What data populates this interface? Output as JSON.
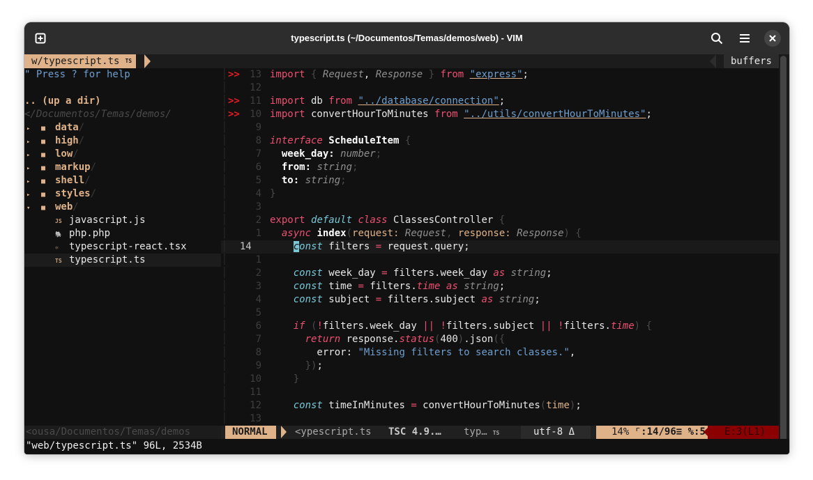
{
  "window": {
    "title": "typescript.ts (~/Documentos/Temas/demos/web) - VIM",
    "new_tab_icon": "plus-square-icon",
    "search_icon": "search-icon",
    "menu_icon": "hamburger-menu-icon",
    "close_icon": "close-icon"
  },
  "tabline": {
    "active_tab": "w/typescript.ts",
    "active_tab_badge": "TS",
    "right_label": "buffers"
  },
  "tree": {
    "help": "\" Press ? for help",
    "updir": ".. (up a dir)",
    "cwd": "</Documentos/Temas/demos/",
    "dirs": [
      {
        "name": "data",
        "expanded": false
      },
      {
        "name": "high",
        "expanded": false
      },
      {
        "name": "low",
        "expanded": false
      },
      {
        "name": "markup",
        "expanded": false
      },
      {
        "name": "shell",
        "expanded": false
      },
      {
        "name": "styles",
        "expanded": false
      },
      {
        "name": "web",
        "expanded": true
      }
    ],
    "dir_slash": "/",
    "collapsed_glyph": "▸",
    "expanded_glyph": "▾",
    "folder_glyph": "■",
    "files": [
      {
        "icon": "JS",
        "name": "javascript.js"
      },
      {
        "icon": "🐘",
        "name": "php.php"
      },
      {
        "icon": "⚛",
        "name": "typescript-react.tsx"
      },
      {
        "icon": "TS",
        "name": "typescript.ts",
        "selected": true
      }
    ]
  },
  "editor": {
    "sign_marker": ">>",
    "current_line": "14",
    "lines": [
      {
        "sign": ">>",
        "nr": "13"
      },
      {
        "sign": "",
        "nr": "12"
      },
      {
        "sign": ">>",
        "nr": "11"
      },
      {
        "sign": ">>",
        "nr": "10"
      },
      {
        "sign": "",
        "nr": "9"
      },
      {
        "sign": "",
        "nr": "8"
      },
      {
        "sign": "",
        "nr": "7"
      },
      {
        "sign": "",
        "nr": "6"
      },
      {
        "sign": "",
        "nr": "5"
      },
      {
        "sign": "",
        "nr": "4"
      },
      {
        "sign": "",
        "nr": "3"
      },
      {
        "sign": "",
        "nr": "2"
      },
      {
        "sign": "",
        "nr": "1"
      },
      {
        "sign": "",
        "nr": "14"
      },
      {
        "sign": "",
        "nr": "1"
      },
      {
        "sign": "",
        "nr": "2"
      },
      {
        "sign": "",
        "nr": "3"
      },
      {
        "sign": "",
        "nr": "4"
      },
      {
        "sign": "",
        "nr": "5"
      },
      {
        "sign": "",
        "nr": "6"
      },
      {
        "sign": "",
        "nr": "7"
      },
      {
        "sign": "",
        "nr": "8"
      },
      {
        "sign": "",
        "nr": "9"
      },
      {
        "sign": "",
        "nr": "10"
      },
      {
        "sign": "",
        "nr": "11"
      },
      {
        "sign": "",
        "nr": "12"
      },
      {
        "sign": "",
        "nr": "13"
      }
    ],
    "code": {
      "import": "import",
      "from": "from",
      "request_t": "Request",
      "response_t": "Response",
      "express": "\"express\"",
      "db": "db",
      "db_path": "\"../database/connection\"",
      "convert": "convertHourToMinutes",
      "convert_path": "\"../utils/convertHourToMinutes\"",
      "interface": "interface",
      "schedule": "ScheduleItem",
      "week_day": "week_day",
      "from_field": "from",
      "to_field": "to",
      "number": "number",
      "string": "string",
      "export": "export",
      "default": "default",
      "class": "class",
      "controller": "ClassesController",
      "async": "async",
      "index": "index",
      "request": "request",
      "response": "response",
      "const": "const",
      "cursor_char": "c",
      "const_rest": "onst",
      "filters": "filters",
      "query": "request.query;",
      "filters_week": "filters.week_day",
      "time": "time",
      "filters_dot": "filters.",
      "subject": "subject",
      "filters_subject": "filters.subject",
      "as": "as",
      "if": "if",
      "return": "return",
      "status": "status",
      "status_code": "400",
      "json": ".json",
      "error_key": "error:",
      "error_msg": "\"Missing filters to search classes.\"",
      "time_in_minutes": "timeInMinutes",
      "response_dot": "response."
    }
  },
  "statusline": {
    "left_path": "<ousa/Documentos/Temas/demos",
    "mode": "NORMAL",
    "file": "<ypescript.ts",
    "tsc": "TSC 4.9.…",
    "filetype": "typ…",
    "filetype_badge": "TS",
    "encoding": "utf-8",
    "os_icon": "linux-tux-icon",
    "percent": "14%",
    "line_col": ":14/96≡",
    "col": "%:5",
    "errors": "E:3(L1)"
  },
  "cmdline": {
    "message": "\"web/typescript.ts\" 96L, 2534B"
  }
}
